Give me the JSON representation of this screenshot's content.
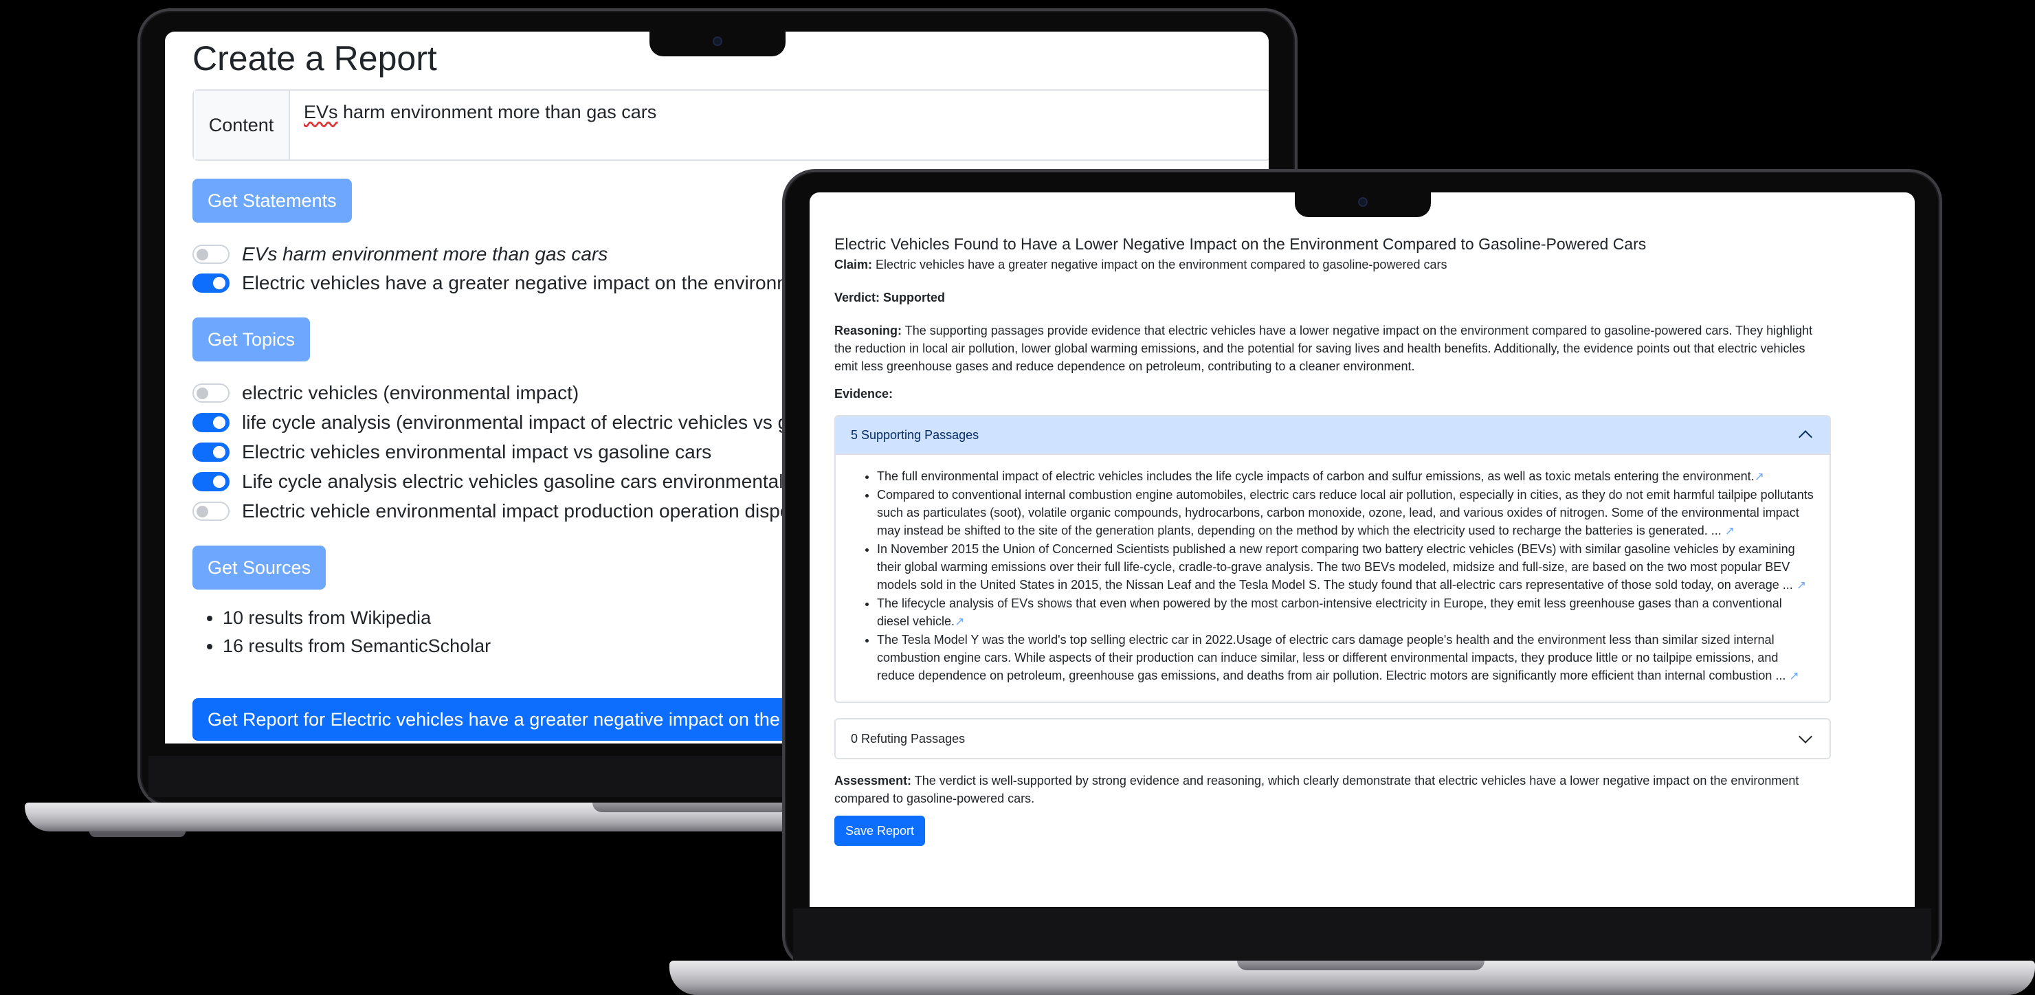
{
  "back": {
    "title": "Create a Report",
    "content_label": "Content",
    "content_value_prefix": "EVs",
    "content_value_rest": " harm environment more than gas cars",
    "get_statements_label": "Get Statements",
    "statements": [
      {
        "text": "EVs harm environment more than gas cars",
        "checked": false
      },
      {
        "text": "Electric vehicles have a greater negative impact on the environme",
        "checked": true
      }
    ],
    "get_topics_label": "Get Topics",
    "topics": [
      {
        "text": "electric vehicles (environmental impact)",
        "checked": false
      },
      {
        "text": "life cycle analysis (environmental impact of electric vehicles vs ga",
        "checked": true
      },
      {
        "text": "Electric vehicles environmental impact vs gasoline cars",
        "checked": true
      },
      {
        "text": "Life cycle analysis electric vehicles gasoline cars environmental im",
        "checked": true
      },
      {
        "text": "Electric vehicle environmental impact production operation dispos",
        "checked": false
      }
    ],
    "get_sources_label": "Get Sources",
    "sources": [
      "10 results from Wikipedia",
      "16 results from SemanticScholar"
    ],
    "get_report_label": "Get Report for Electric vehicles have a greater negative impact on the"
  },
  "front": {
    "title": "Electric Vehicles Found to Have a Lower Negative Impact on the Environment Compared to Gasoline-Powered Cars",
    "claim_label": "Claim:",
    "claim_text": "Electric vehicles have a greater negative impact on the environment compared to gasoline-powered cars",
    "verdict_text": "Verdict: Supported",
    "reasoning_label": "Reasoning:",
    "reasoning_text": "The supporting passages provide evidence that electric vehicles have a lower negative impact on the environment compared to gasoline-powered cars. They highlight the reduction in local air pollution, lower global warming emissions, and the potential for saving lives and health benefits. Additionally, the evidence points out that electric vehicles emit less greenhouse gases and reduce dependence on petroleum, contributing to a cleaner environment.",
    "evidence_label": "Evidence:",
    "supporting_header": "5 Supporting Passages",
    "passages": [
      "The full environmental impact of electric vehicles includes the life cycle impacts of carbon and sulfur emissions, as well as toxic metals entering the environment.",
      "Compared to conventional internal combustion engine automobiles, electric cars reduce local air pollution, especially in cities, as they do not emit harmful tailpipe pollutants such as particulates (soot), volatile organic compounds, hydrocarbons, carbon monoxide, ozone, lead, and various oxides of nitrogen. Some of the environmental impact may instead be shifted to the site of the generation plants, depending on the method by which the electricity used to recharge the batteries is generated. ...",
      "In November 2015 the Union of Concerned Scientists published a new report comparing two battery electric vehicles (BEVs) with similar gasoline vehicles by examining their global warming emissions over their full life-cycle, cradle-to-grave analysis. The two BEVs modeled, midsize and full-size, are based on the two most popular BEV models sold in the United States in 2015, the Nissan Leaf and the Tesla Model S. The study found that all-electric cars representative of those sold today, on average ...",
      "The lifecycle analysis of EVs shows that even when powered by the most carbon-intensive electricity in Europe, they emit less greenhouse gases than a conventional diesel vehicle.",
      "The Tesla Model Y was the world's top selling electric car in 2022.Usage of electric cars damage people's health and the environment less than similar sized internal combustion engine cars. While aspects of their production can induce similar, less or different environmental impacts, they produce little or no tailpipe emissions, and reduce dependence on petroleum, greenhouse gas emissions, and deaths from air pollution. Electric motors are significantly more efficient than internal combustion ..."
    ],
    "refuting_header": "0 Refuting Passages",
    "assessment_label": "Assessment:",
    "assessment_text": "The verdict is well-supported by strong evidence and reasoning, which clearly demonstrate that electric vehicles have a lower negative impact on the environment compared to gasoline-powered cars.",
    "save_label": "Save Report",
    "colors": {
      "primary": "#0d6efd",
      "primary_light": "#6ea8fe",
      "accordion_open": "#cfe2ff"
    }
  }
}
